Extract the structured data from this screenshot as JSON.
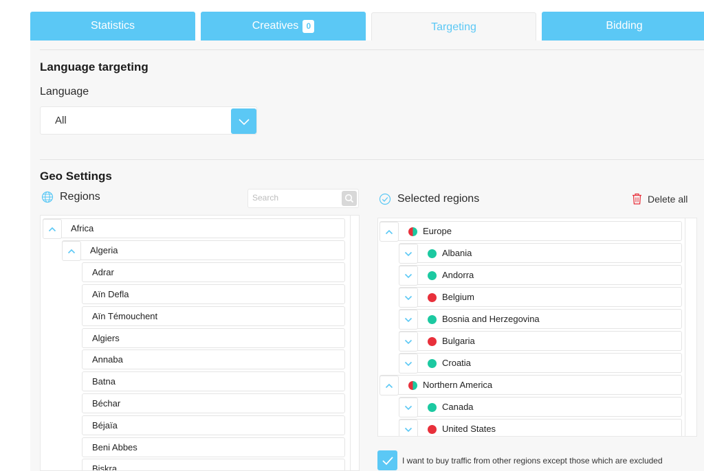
{
  "tabs": [
    {
      "label": "Statistics"
    },
    {
      "label": "Creatives",
      "badge": "0"
    },
    {
      "label": "Targeting"
    },
    {
      "label": "Bidding"
    }
  ],
  "language_section": {
    "title": "Language targeting",
    "field_label": "Language",
    "selected": "All"
  },
  "geo": {
    "title": "Geo Settings",
    "regions_label": "Regions",
    "search_placeholder": "Search",
    "selected_label": "Selected regions",
    "delete_all_label": "Delete all",
    "tree": [
      "Africa",
      "Algeria",
      "Adrar",
      "Aïn Defla",
      "Aïn Témouchent",
      "Algiers",
      "Annaba",
      "Batna",
      "Béchar",
      "Béjaïa",
      "Beni Abbes",
      "Biskra"
    ],
    "selected": [
      "Europe",
      "Albania",
      "Andorra",
      "Belgium",
      "Bosnia and Herzegovina",
      "Bulgaria",
      "Croatia",
      "Northern America",
      "Canada",
      "United States"
    ],
    "checkbox_label": "I want to buy traffic from other regions except those which are excluded"
  },
  "colors": {
    "accent": "#5bc8f5",
    "included": "#1cc9a1",
    "excluded": "#e8303b"
  }
}
